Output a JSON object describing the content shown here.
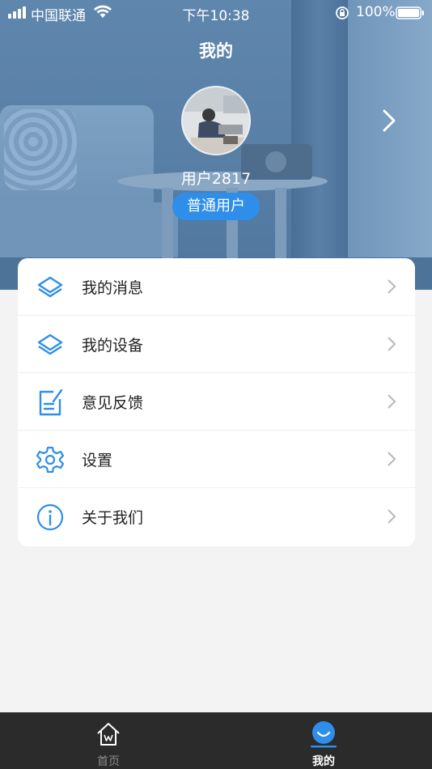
{
  "status_bar": {
    "carrier": "中国联通",
    "time": "下午10:38",
    "battery_percent": "100%"
  },
  "header": {
    "title": "我的"
  },
  "profile": {
    "username": "用户2817",
    "role": "普通用户"
  },
  "menu": {
    "items": [
      {
        "label": "我的消息",
        "icon": "layers-icon"
      },
      {
        "label": "我的设备",
        "icon": "layers-icon"
      },
      {
        "label": "意见反馈",
        "icon": "edit-document-icon"
      },
      {
        "label": "设置",
        "icon": "gear-icon"
      },
      {
        "label": "关于我们",
        "icon": "info-icon"
      }
    ]
  },
  "tab_bar": {
    "tabs": [
      {
        "label": "首页",
        "icon": "home-icon",
        "active": false
      },
      {
        "label": "我的",
        "icon": "profile-smile-icon",
        "active": true
      }
    ]
  },
  "colors": {
    "accent": "#2e8ee9",
    "tab_bar_bg": "#2b2b2b",
    "page_bg": "#f3f3f4"
  }
}
